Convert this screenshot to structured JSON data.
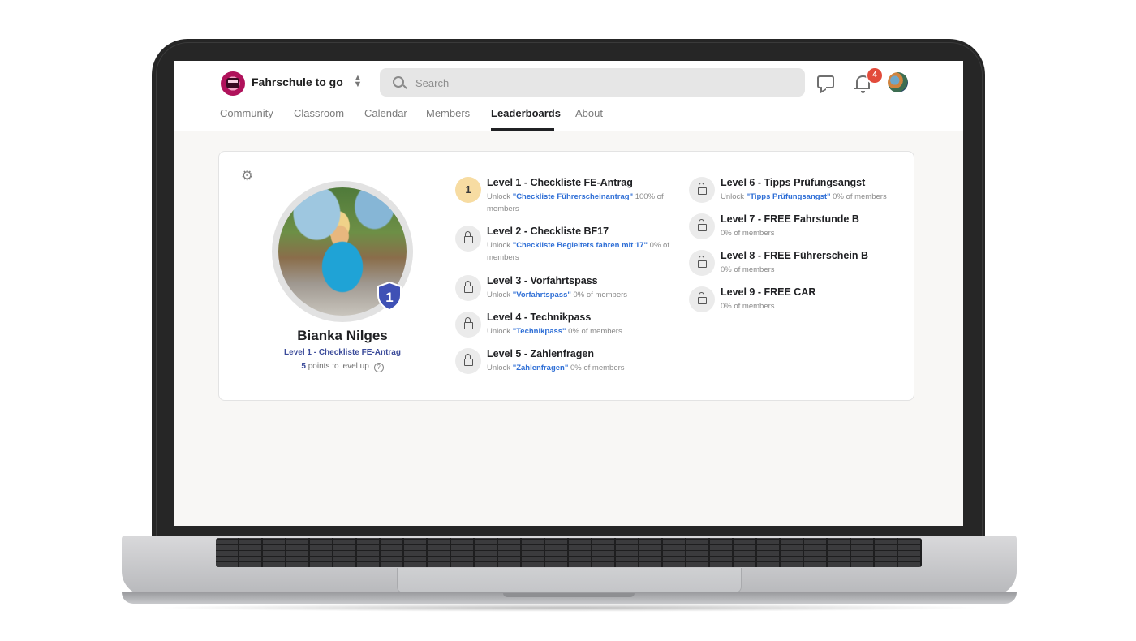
{
  "app": {
    "brand": "Fahrschule to go",
    "search_placeholder": "Search",
    "notification_count": "4"
  },
  "tabs": [
    {
      "label": "Community"
    },
    {
      "label": "Classroom"
    },
    {
      "label": "Calendar"
    },
    {
      "label": "Members"
    },
    {
      "label": "Leaderboards",
      "active": true
    },
    {
      "label": "About"
    }
  ],
  "profile": {
    "name": "Bianka Nilges",
    "level_badge": "1",
    "level_label": "Level 1 - Checkliste FE-Antrag",
    "points": "5",
    "points_suffix": "points to level up"
  },
  "levels": [
    {
      "number": "1",
      "title": "Level 1 - Checkliste FE-Antrag",
      "unlock_prefix": "Unlock ",
      "unlock_item": "\"Checkliste Führerscheinantrag\"",
      "members": " 100% of members",
      "current": true
    },
    {
      "number": "2",
      "title": "Level 2 - Checkliste BF17",
      "unlock_prefix": "Unlock ",
      "unlock_item": "\"Checkliste Begleitets fahren mit 17\"",
      "members": " 0% of members"
    },
    {
      "number": "3",
      "title": "Level 3 - Vorfahrtspass",
      "unlock_prefix": "Unlock ",
      "unlock_item": "\"Vorfahrtspass\"",
      "members": " 0% of members"
    },
    {
      "number": "4",
      "title": "Level 4 - Technikpass",
      "unlock_prefix": "Unlock ",
      "unlock_item": "\"Technikpass\"",
      "members": " 0% of members"
    },
    {
      "number": "5",
      "title": "Level 5 - Zahlenfragen",
      "unlock_prefix": "Unlock ",
      "unlock_item": "\"Zahlenfragen\"",
      "members": " 0% of members"
    },
    {
      "number": "6",
      "title": "Level 6 - Tipps Prüfungsangst",
      "unlock_prefix": "Unlock ",
      "unlock_item": "\"Tipps Prüfungsangst\"",
      "members": " 0% of members"
    },
    {
      "number": "7",
      "title": "Level 7 - FREE Fahrstunde B",
      "unlock_prefix": "",
      "unlock_item": "",
      "members": "0% of members"
    },
    {
      "number": "8",
      "title": "Level 8 - FREE Führerschein B",
      "unlock_prefix": "",
      "unlock_item": "",
      "members": "0% of members"
    },
    {
      "number": "9",
      "title": "Level 9 - FREE CAR",
      "unlock_prefix": "",
      "unlock_item": "",
      "members": "0% of members"
    }
  ],
  "colors": {
    "accent_link": "#2f6fd6",
    "current_level": "#f7dca2",
    "badge": "#e24b3b",
    "shield": "#3f51b5"
  }
}
